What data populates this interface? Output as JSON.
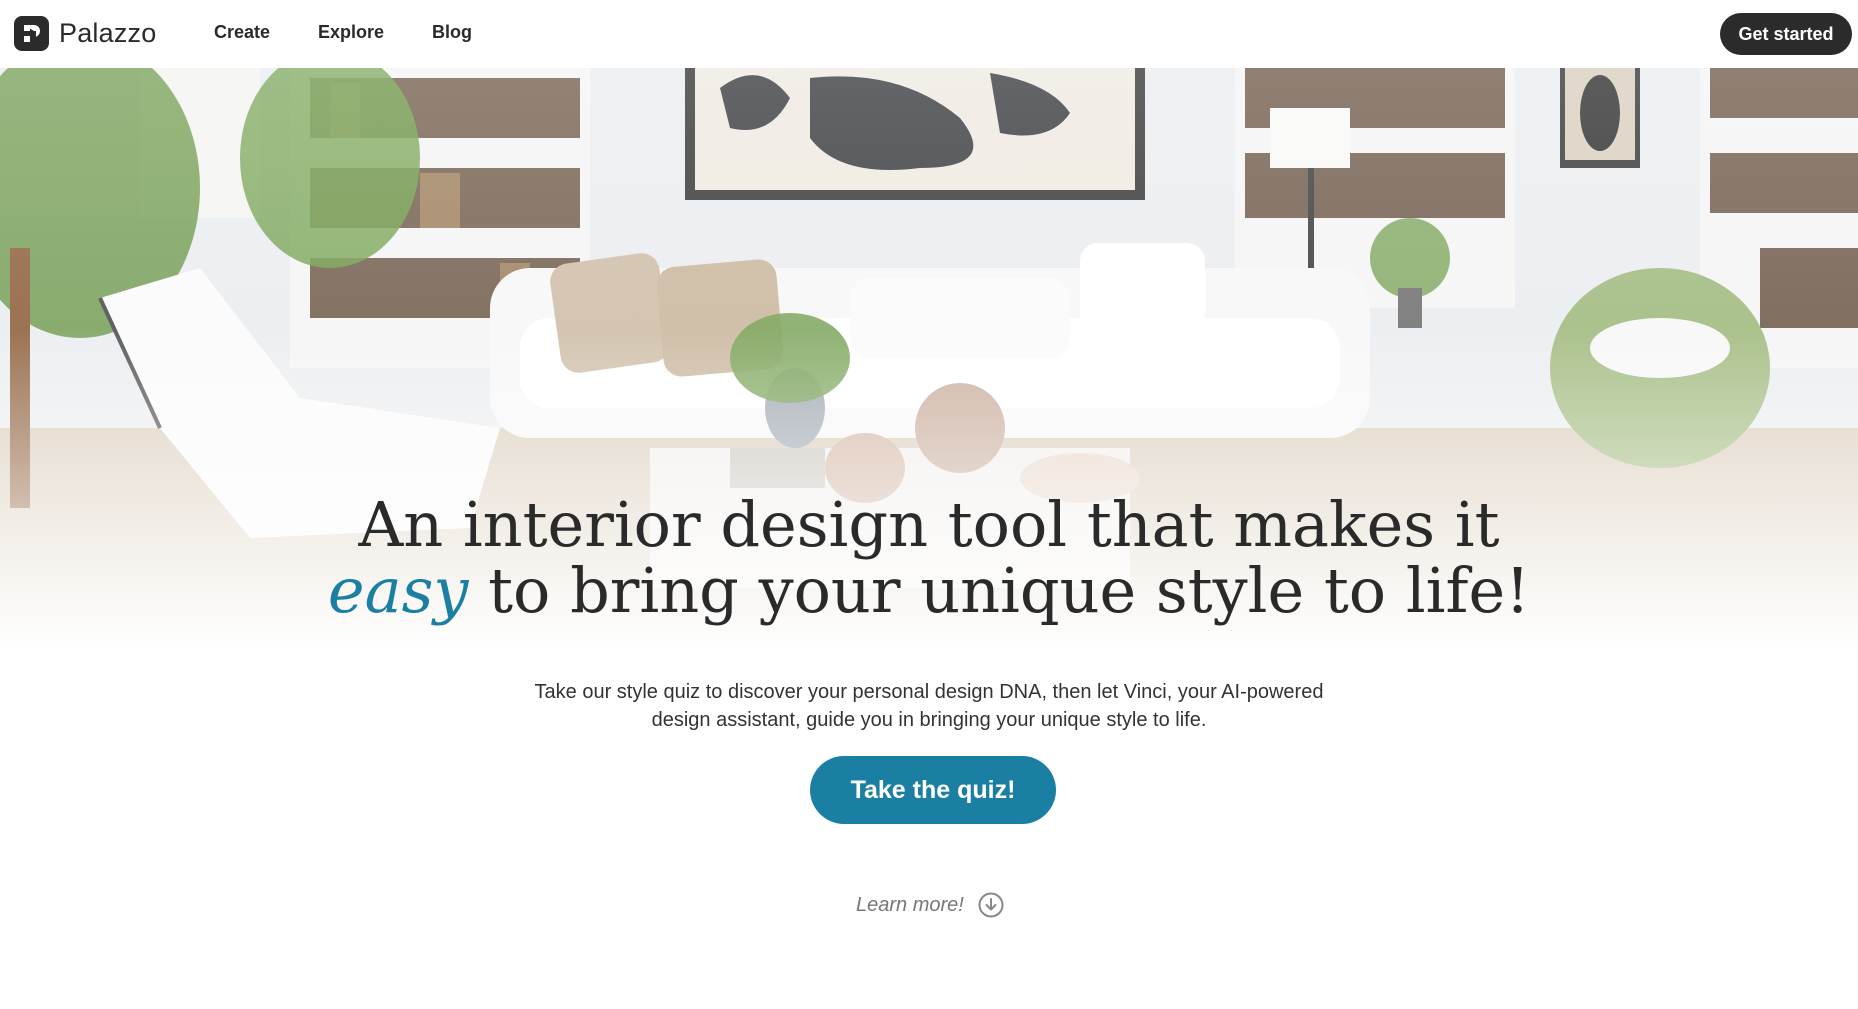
{
  "brand": {
    "name": "Palazzo",
    "logo_icon": "palazzo-logo-icon"
  },
  "nav": {
    "links": [
      "Create",
      "Explore",
      "Blog"
    ],
    "cta": "Get started"
  },
  "hero": {
    "headline_line1": "An interior design tool that makes it",
    "headline_accent": "easy",
    "headline_line2_rest": " to bring your unique style to life!",
    "subtitle": "Take our style quiz to discover your personal design DNA, then let Vinci, your AI-powered design assistant, guide you in bringing your unique style to life.",
    "quiz_button": "Take the quiz!",
    "learn_more": "Learn more!",
    "learn_more_icon": "arrow-down-circle-icon",
    "accent_color": "#1b7fa3"
  }
}
